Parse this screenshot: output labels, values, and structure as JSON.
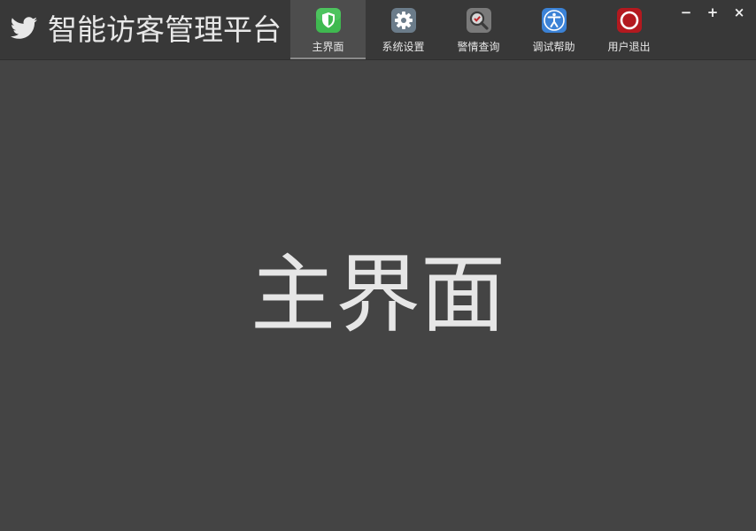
{
  "app": {
    "title": "智能访客管理平台"
  },
  "nav": {
    "items": [
      {
        "label": "主界面",
        "icon": "shield-icon",
        "color": "#3fb950",
        "active": true
      },
      {
        "label": "系统设置",
        "icon": "gear-icon",
        "color": "#6b7c8a",
        "active": false
      },
      {
        "label": "警情查询",
        "icon": "search-alert-icon",
        "color": "#7a7a7a",
        "active": false
      },
      {
        "label": "调试帮助",
        "icon": "accessibility-icon",
        "color": "#3b82d6",
        "active": false
      },
      {
        "label": "用户退出",
        "icon": "power-icon",
        "color": "#b3191f",
        "active": false
      }
    ]
  },
  "window_controls": {
    "minimize": "−",
    "maximize": "+",
    "close": "×"
  },
  "main": {
    "title": "主界面"
  },
  "colors": {
    "background": "#444444",
    "titlebar": "#383838",
    "text": "#e6e6e6"
  }
}
